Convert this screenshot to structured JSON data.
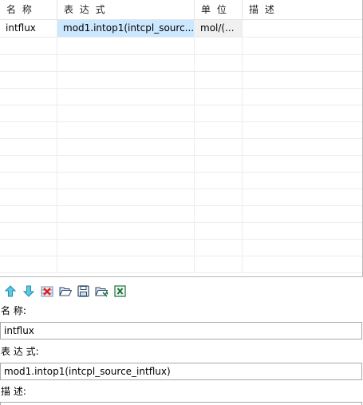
{
  "table": {
    "headers": [
      "名 称",
      "表 达 式",
      "单 位",
      "描 述"
    ],
    "rows": [
      {
        "name": "intflux",
        "expression": "mod1.intop1(intcpl_sourc...",
        "unit": "mol/(...",
        "description": ""
      }
    ]
  },
  "toolbar": {
    "buttons": [
      {
        "name": "move-up-button",
        "icon": "arrow-up-icon"
      },
      {
        "name": "move-down-button",
        "icon": "arrow-down-icon"
      },
      {
        "name": "delete-button",
        "icon": "delete-icon"
      },
      {
        "name": "open-button",
        "icon": "folder-open-icon"
      },
      {
        "name": "save-button",
        "icon": "save-icon"
      },
      {
        "name": "load-button",
        "icon": "folder-load-icon"
      },
      {
        "name": "excel-button",
        "icon": "excel-icon"
      }
    ]
  },
  "form": {
    "name_label": "名 称:",
    "name_value": "intflux",
    "expression_label": "表 达 式:",
    "expression_value": "mod1.intop1(intcpl_source_intflux)",
    "description_label": "描 述:",
    "description_value": ""
  }
}
